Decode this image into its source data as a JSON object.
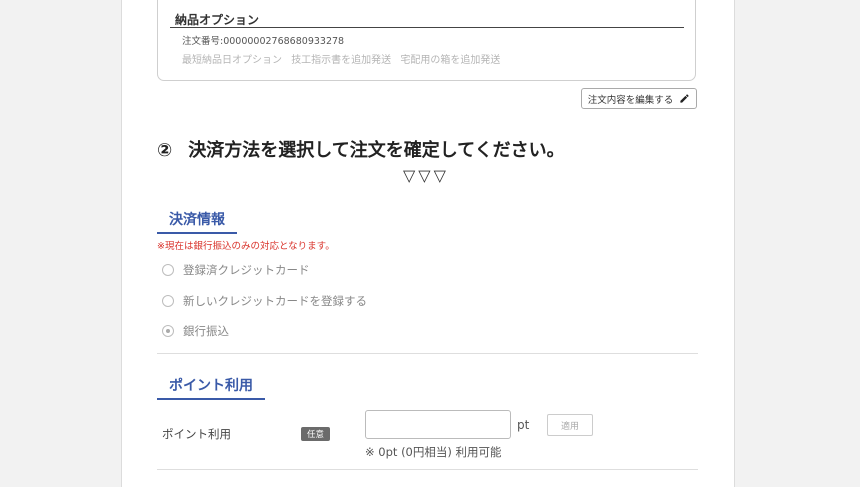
{
  "delivery_card": {
    "title": "納品オプション",
    "order_number": "注文番号:00000002768680933278",
    "options": [
      "最短納品日オプション",
      "技工指示書を追加発送",
      "宅配用の箱を追加発送"
    ]
  },
  "edit_button": {
    "label": "注文内容を編集する",
    "icon": "pencil-icon"
  },
  "step": {
    "number": "②",
    "title": "決済方法を選択して注文を確定してください。",
    "arrows": "▽▽▽"
  },
  "payment": {
    "heading": "決済情報",
    "notice": "※現在は銀行振込のみの対応となります。",
    "options": [
      {
        "label": "登録済クレジットカード",
        "selected": false
      },
      {
        "label": "新しいクレジットカードを登録する",
        "selected": false
      },
      {
        "label": "銀行振込",
        "selected": true
      }
    ]
  },
  "points": {
    "heading": "ポイント利用",
    "row_label": "ポイント利用",
    "badge": "任意",
    "input_value": "",
    "unit": "pt",
    "apply_label": "適用",
    "note": "※ 0pt (0円相当) 利用可能"
  },
  "colors": {
    "accent": "#3a5aa8",
    "notice": "#d9332b"
  }
}
